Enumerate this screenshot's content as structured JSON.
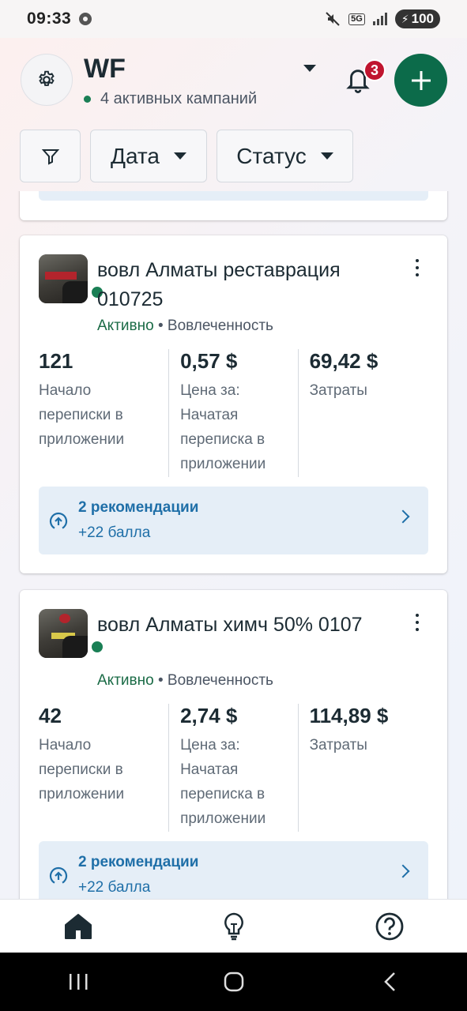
{
  "status_bar": {
    "time": "09:33",
    "network": "5G",
    "battery": "100"
  },
  "header": {
    "account_name": "WF",
    "active_campaigns": "4 активных кампаний",
    "notifications_count": "3"
  },
  "filters": {
    "date_label": "Дата",
    "status_label": "Статус"
  },
  "campaigns": [
    {
      "title": "вовл Алматы реставрация 010725",
      "status": "Активно",
      "objective": "Вовлеченность",
      "metrics": [
        {
          "value": "121",
          "label": "Начало переписки в приложении"
        },
        {
          "value": "0,57 $",
          "label": "Цена за: Начатая переписка в приложении"
        },
        {
          "value": "69,42 $",
          "label": "Затраты"
        }
      ],
      "recommendations": {
        "title": "2 рекомендации",
        "points": "+22 балла"
      }
    },
    {
      "title": "вовл Алматы химч 50% 0107",
      "status": "Активно",
      "objective": "Вовлеченность",
      "metrics": [
        {
          "value": "42",
          "label": "Начало переписки в приложении"
        },
        {
          "value": "2,74 $",
          "label": "Цена за: Начатая переписка в приложении"
        },
        {
          "value": "114,89 $",
          "label": "Затраты"
        }
      ],
      "recommendations": {
        "title": "2 рекомендации",
        "points": "+22 балла"
      }
    }
  ],
  "colors": {
    "brand_green": "#0c6b4a",
    "status_green": "#1a7f55",
    "badge_red": "#c0152f",
    "rec_blue": "#1f6fa8",
    "rec_bg": "#e5eef7"
  },
  "icons": {
    "settings": "gear-icon",
    "notifications": "bell-icon",
    "create": "plus-icon",
    "filter": "funnel-icon",
    "recommendation": "arrow-up-circle-icon",
    "nav_home": "home-icon",
    "nav_tips": "lightbulb-icon",
    "nav_help": "help-icon"
  }
}
